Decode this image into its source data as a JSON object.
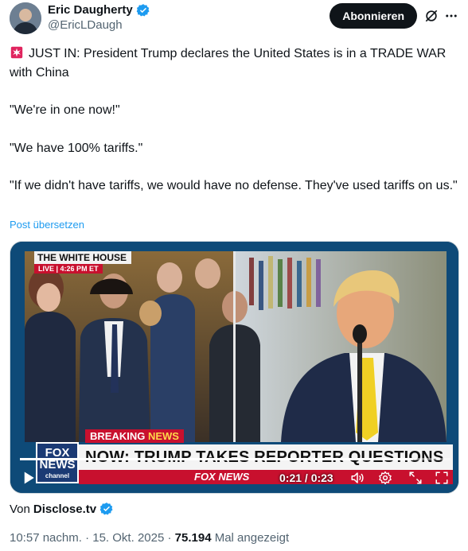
{
  "author": {
    "display_name": "Eric Daugherty",
    "handle": "@EricLDaugh"
  },
  "follow_button": {
    "label": "Abonnieren"
  },
  "tweet": {
    "line1": "JUST IN: President Trump declares the United States is in a TRADE WAR with China",
    "line2": "\"We're in one now!\"",
    "line3": "\"We have 100% tariffs.\"",
    "line4": "\"If we didn't have tariffs, we would have no defense. They've used tariffs on us.\"",
    "translate_link": "Post übersetzen"
  },
  "video": {
    "location_label": "THE WHITE HOUSE",
    "live_label": "LIVE",
    "live_time": "4:26 PM ET",
    "breaking_word1": "BREAKING",
    "breaking_word2": "NEWS",
    "chyron": "NOW: TRUMP TAKES REPORTER QUESTIONS",
    "logo_line1": "FOX",
    "logo_line2": "NEWS",
    "logo_line3": "channel",
    "ticker": "FOX NEWS",
    "time_display": "0:21 / 0:23",
    "progress_fraction": 0.913
  },
  "source": {
    "prefix": "Von",
    "name": "Disclose.tv"
  },
  "meta": {
    "time": "10:57 nachm.",
    "date": "15. Okt. 2025",
    "views": "75.194",
    "views_label": "Mal angezeigt",
    "separator": "·"
  },
  "colors": {
    "accent": "#1d9bf0",
    "fox_red": "#c8102e",
    "text": "#0f1419",
    "muted": "#536471"
  }
}
